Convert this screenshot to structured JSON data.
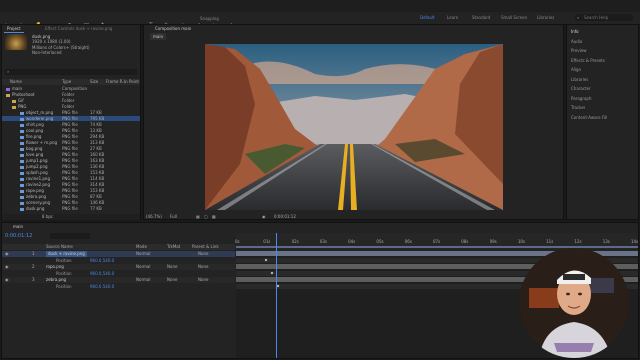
{
  "toolbar": {
    "snapping_label": "Snapping",
    "workspaces": [
      "Default",
      "Learn",
      "Standard",
      "Small Screen",
      "Libraries"
    ],
    "search_placeholder": "Search Help"
  },
  "project": {
    "tab_label": "Project",
    "effect_controls_label": "Effect Controls dusk + ravine.png",
    "selected_name": "dusk.png",
    "selected_info_1": "1920 x 1080 (1.00)",
    "selected_info_2": "Millions of Colors+ (Straight)",
    "selected_info_3": "Non-Interlaced",
    "columns": [
      "Name",
      "Type",
      "Size",
      "Frame R...",
      "In Point"
    ],
    "items": [
      {
        "name": "main",
        "type": "Composition",
        "size": ""
      },
      {
        "name": "Photoshoot",
        "type": "Folder",
        "size": ""
      },
      {
        "name": "Gif",
        "type": "Folder",
        "size": ""
      },
      {
        "name": "PNG",
        "type": "Folder",
        "size": ""
      },
      {
        "name": "object_m.png",
        "type": "PNG file",
        "size": "17 KB"
      },
      {
        "name": "wonderer.png",
        "type": "PNG file",
        "size": "795 KB"
      },
      {
        "name": "shirt.png",
        "type": "PNG file",
        "size": "74 KB"
      },
      {
        "name": "cool.png",
        "type": "PNG file",
        "size": "13 KB"
      },
      {
        "name": "fire.png",
        "type": "PNG file",
        "size": "294 KB"
      },
      {
        "name": "flower + m.png",
        "type": "PNG file",
        "size": "313 KB"
      },
      {
        "name": "bag.png",
        "type": "PNG file",
        "size": "27 KB"
      },
      {
        "name": "love.png",
        "type": "PNG file",
        "size": "160 KB"
      },
      {
        "name": "jump1.png",
        "type": "PNG file",
        "size": "163 KB"
      },
      {
        "name": "jump2.png",
        "type": "PNG file",
        "size": "136 KB"
      },
      {
        "name": "splash.png",
        "type": "PNG file",
        "size": "153 KB"
      },
      {
        "name": "ravine1.png",
        "type": "PNG file",
        "size": "114 KB"
      },
      {
        "name": "ravine2.png",
        "type": "PNG file",
        "size": "314 KB"
      },
      {
        "name": "rope.png",
        "type": "PNG file",
        "size": "153 KB"
      },
      {
        "name": "zebra.png",
        "type": "PNG file",
        "size": "87 KB"
      },
      {
        "name": "scenery.png",
        "type": "PNG file",
        "size": "146 KB"
      },
      {
        "name": "dusk.png",
        "type": "PNG file",
        "size": "77 KB"
      }
    ],
    "bpc": "8 bpc"
  },
  "composition": {
    "tab_label": "Composition main",
    "sub_tab": "main",
    "zoom": "(46.7%)",
    "resolution": "Full",
    "timecode": "0:00:01:12"
  },
  "right_panel": {
    "items": [
      "Info",
      "Audio",
      "Preview",
      "Effects & Presets",
      "Align",
      "Libraries",
      "Character",
      "Paragraph",
      "Tracker",
      "Content-Aware Fill"
    ]
  },
  "timeline": {
    "tab_label": "main",
    "timecode": "0:00:01:12",
    "column_source": "Source Name",
    "column_mode": "Mode",
    "column_trkmat": "TrkMat",
    "column_parent": "Parent & Link",
    "ruler_labels": [
      "0s",
      "01s",
      "02s",
      "03s",
      "04s",
      "05s",
      "06s",
      "07s",
      "08s",
      "09s",
      "10s",
      "11s",
      "12s",
      "13s",
      "14s"
    ],
    "layers": [
      {
        "num": "1",
        "name": "dusk + ravine.png",
        "mode": "Normal",
        "trkmat": "",
        "parent": "None",
        "selected": true
      },
      {
        "num": "",
        "name": "Position",
        "mode": "",
        "trkmat": "",
        "parent": "",
        "value": "960.0,540.0"
      },
      {
        "num": "2",
        "name": "ropo.png",
        "mode": "Normal",
        "trkmat": "None",
        "parent": "None",
        "selected": false
      },
      {
        "num": "",
        "name": "Position",
        "mode": "",
        "trkmat": "",
        "parent": "",
        "value": "960.0,540.0"
      },
      {
        "num": "3",
        "name": "zebra.png",
        "mode": "Normal",
        "trkmat": "None",
        "parent": "None",
        "selected": false
      },
      {
        "num": "",
        "name": "Position",
        "mode": "",
        "trkmat": "",
        "parent": "",
        "value": "960.0,540.0"
      }
    ],
    "playhead_fraction": 0.1
  }
}
